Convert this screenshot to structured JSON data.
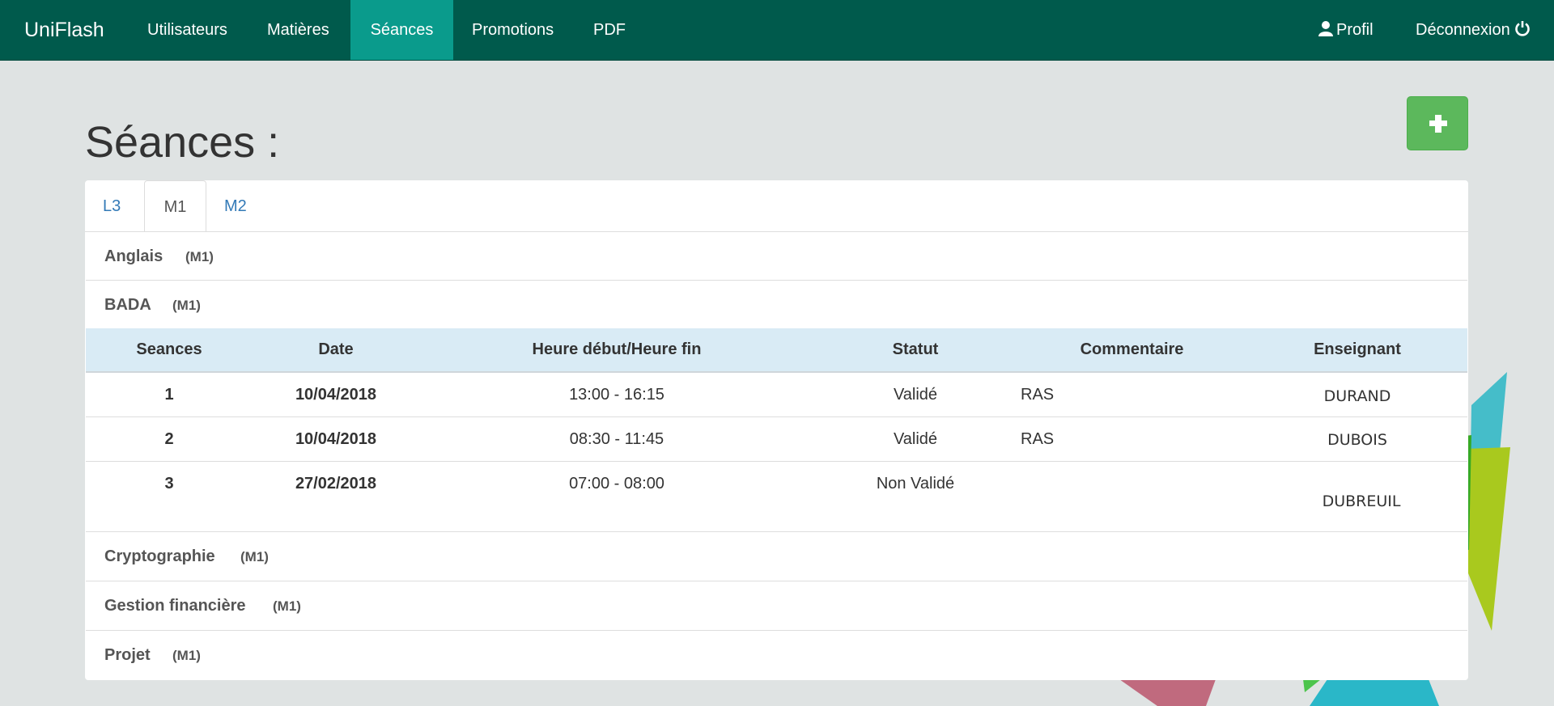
{
  "navbar": {
    "brand": "UniFlash",
    "items": [
      {
        "label": "Utilisateurs"
      },
      {
        "label": "Matières"
      },
      {
        "label": "Séances",
        "active": true
      },
      {
        "label": "Promotions"
      },
      {
        "label": "PDF"
      }
    ],
    "profile_label": "Profil",
    "logout_label": "Déconnexion",
    "profile_icon": "user-icon",
    "logout_icon": "power-icon",
    "color": "#005a4c",
    "active_color": "#0a9b8c"
  },
  "page": {
    "title": "Séances :",
    "add_button_icon": "plus-icon",
    "add_button_color": "#5cb85c"
  },
  "tabs": [
    {
      "label": "L3"
    },
    {
      "label": "M1",
      "active": true
    },
    {
      "label": "M2"
    }
  ],
  "groups": [
    {
      "title": "Anglais",
      "level": "(M1)",
      "expanded": false
    },
    {
      "title": "BADA",
      "level": "(M1)",
      "expanded": true
    },
    {
      "title": "Cryptographie",
      "level": "(M1)",
      "expanded": false
    },
    {
      "title": "Gestion financière",
      "level": "(M1)",
      "expanded": false
    },
    {
      "title": "Projet",
      "level": "(M1)",
      "expanded": false
    }
  ],
  "table": {
    "headers": [
      "Seances",
      "Date",
      "Heure début/Heure fin",
      "Statut",
      "Commentaire",
      "Enseignant"
    ],
    "rows": [
      {
        "seance": "1",
        "date": "10/04/2018",
        "hours": "13:00 - 16:15",
        "status": "Validé",
        "comment": "RAS",
        "teacher": "DURAND"
      },
      {
        "seance": "2",
        "date": "10/04/2018",
        "hours": "08:30 - 11:45",
        "status": "Validé",
        "comment": "RAS",
        "teacher": "DUBOIS"
      },
      {
        "seance": "3",
        "date": "27/02/2018",
        "hours": "07:00 - 08:00",
        "status": "Non Validé",
        "comment": "",
        "teacher": "DUBREUIL"
      }
    ],
    "header_bg": "#d9ebf5"
  },
  "background_color": "#dfe3e3"
}
